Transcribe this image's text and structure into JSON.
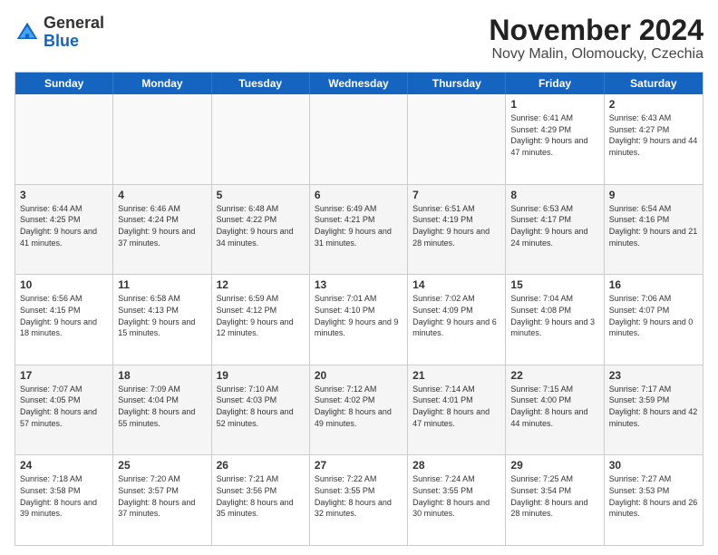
{
  "header": {
    "logo": {
      "general": "General",
      "blue": "Blue"
    },
    "title": "November 2024",
    "subtitle": "Novy Malin, Olomoucky, Czechia"
  },
  "days_of_week": [
    "Sunday",
    "Monday",
    "Tuesday",
    "Wednesday",
    "Thursday",
    "Friday",
    "Saturday"
  ],
  "weeks": [
    [
      {
        "day": "",
        "info": ""
      },
      {
        "day": "",
        "info": ""
      },
      {
        "day": "",
        "info": ""
      },
      {
        "day": "",
        "info": ""
      },
      {
        "day": "",
        "info": ""
      },
      {
        "day": "1",
        "info": "Sunrise: 6:41 AM\nSunset: 4:29 PM\nDaylight: 9 hours and 47 minutes."
      },
      {
        "day": "2",
        "info": "Sunrise: 6:43 AM\nSunset: 4:27 PM\nDaylight: 9 hours and 44 minutes."
      }
    ],
    [
      {
        "day": "3",
        "info": "Sunrise: 6:44 AM\nSunset: 4:25 PM\nDaylight: 9 hours and 41 minutes."
      },
      {
        "day": "4",
        "info": "Sunrise: 6:46 AM\nSunset: 4:24 PM\nDaylight: 9 hours and 37 minutes."
      },
      {
        "day": "5",
        "info": "Sunrise: 6:48 AM\nSunset: 4:22 PM\nDaylight: 9 hours and 34 minutes."
      },
      {
        "day": "6",
        "info": "Sunrise: 6:49 AM\nSunset: 4:21 PM\nDaylight: 9 hours and 31 minutes."
      },
      {
        "day": "7",
        "info": "Sunrise: 6:51 AM\nSunset: 4:19 PM\nDaylight: 9 hours and 28 minutes."
      },
      {
        "day": "8",
        "info": "Sunrise: 6:53 AM\nSunset: 4:17 PM\nDaylight: 9 hours and 24 minutes."
      },
      {
        "day": "9",
        "info": "Sunrise: 6:54 AM\nSunset: 4:16 PM\nDaylight: 9 hours and 21 minutes."
      }
    ],
    [
      {
        "day": "10",
        "info": "Sunrise: 6:56 AM\nSunset: 4:15 PM\nDaylight: 9 hours and 18 minutes."
      },
      {
        "day": "11",
        "info": "Sunrise: 6:58 AM\nSunset: 4:13 PM\nDaylight: 9 hours and 15 minutes."
      },
      {
        "day": "12",
        "info": "Sunrise: 6:59 AM\nSunset: 4:12 PM\nDaylight: 9 hours and 12 minutes."
      },
      {
        "day": "13",
        "info": "Sunrise: 7:01 AM\nSunset: 4:10 PM\nDaylight: 9 hours and 9 minutes."
      },
      {
        "day": "14",
        "info": "Sunrise: 7:02 AM\nSunset: 4:09 PM\nDaylight: 9 hours and 6 minutes."
      },
      {
        "day": "15",
        "info": "Sunrise: 7:04 AM\nSunset: 4:08 PM\nDaylight: 9 hours and 3 minutes."
      },
      {
        "day": "16",
        "info": "Sunrise: 7:06 AM\nSunset: 4:07 PM\nDaylight: 9 hours and 0 minutes."
      }
    ],
    [
      {
        "day": "17",
        "info": "Sunrise: 7:07 AM\nSunset: 4:05 PM\nDaylight: 8 hours and 57 minutes."
      },
      {
        "day": "18",
        "info": "Sunrise: 7:09 AM\nSunset: 4:04 PM\nDaylight: 8 hours and 55 minutes."
      },
      {
        "day": "19",
        "info": "Sunrise: 7:10 AM\nSunset: 4:03 PM\nDaylight: 8 hours and 52 minutes."
      },
      {
        "day": "20",
        "info": "Sunrise: 7:12 AM\nSunset: 4:02 PM\nDaylight: 8 hours and 49 minutes."
      },
      {
        "day": "21",
        "info": "Sunrise: 7:14 AM\nSunset: 4:01 PM\nDaylight: 8 hours and 47 minutes."
      },
      {
        "day": "22",
        "info": "Sunrise: 7:15 AM\nSunset: 4:00 PM\nDaylight: 8 hours and 44 minutes."
      },
      {
        "day": "23",
        "info": "Sunrise: 7:17 AM\nSunset: 3:59 PM\nDaylight: 8 hours and 42 minutes."
      }
    ],
    [
      {
        "day": "24",
        "info": "Sunrise: 7:18 AM\nSunset: 3:58 PM\nDaylight: 8 hours and 39 minutes."
      },
      {
        "day": "25",
        "info": "Sunrise: 7:20 AM\nSunset: 3:57 PM\nDaylight: 8 hours and 37 minutes."
      },
      {
        "day": "26",
        "info": "Sunrise: 7:21 AM\nSunset: 3:56 PM\nDaylight: 8 hours and 35 minutes."
      },
      {
        "day": "27",
        "info": "Sunrise: 7:22 AM\nSunset: 3:55 PM\nDaylight: 8 hours and 32 minutes."
      },
      {
        "day": "28",
        "info": "Sunrise: 7:24 AM\nSunset: 3:55 PM\nDaylight: 8 hours and 30 minutes."
      },
      {
        "day": "29",
        "info": "Sunrise: 7:25 AM\nSunset: 3:54 PM\nDaylight: 8 hours and 28 minutes."
      },
      {
        "day": "30",
        "info": "Sunrise: 7:27 AM\nSunset: 3:53 PM\nDaylight: 8 hours and 26 minutes."
      }
    ]
  ]
}
